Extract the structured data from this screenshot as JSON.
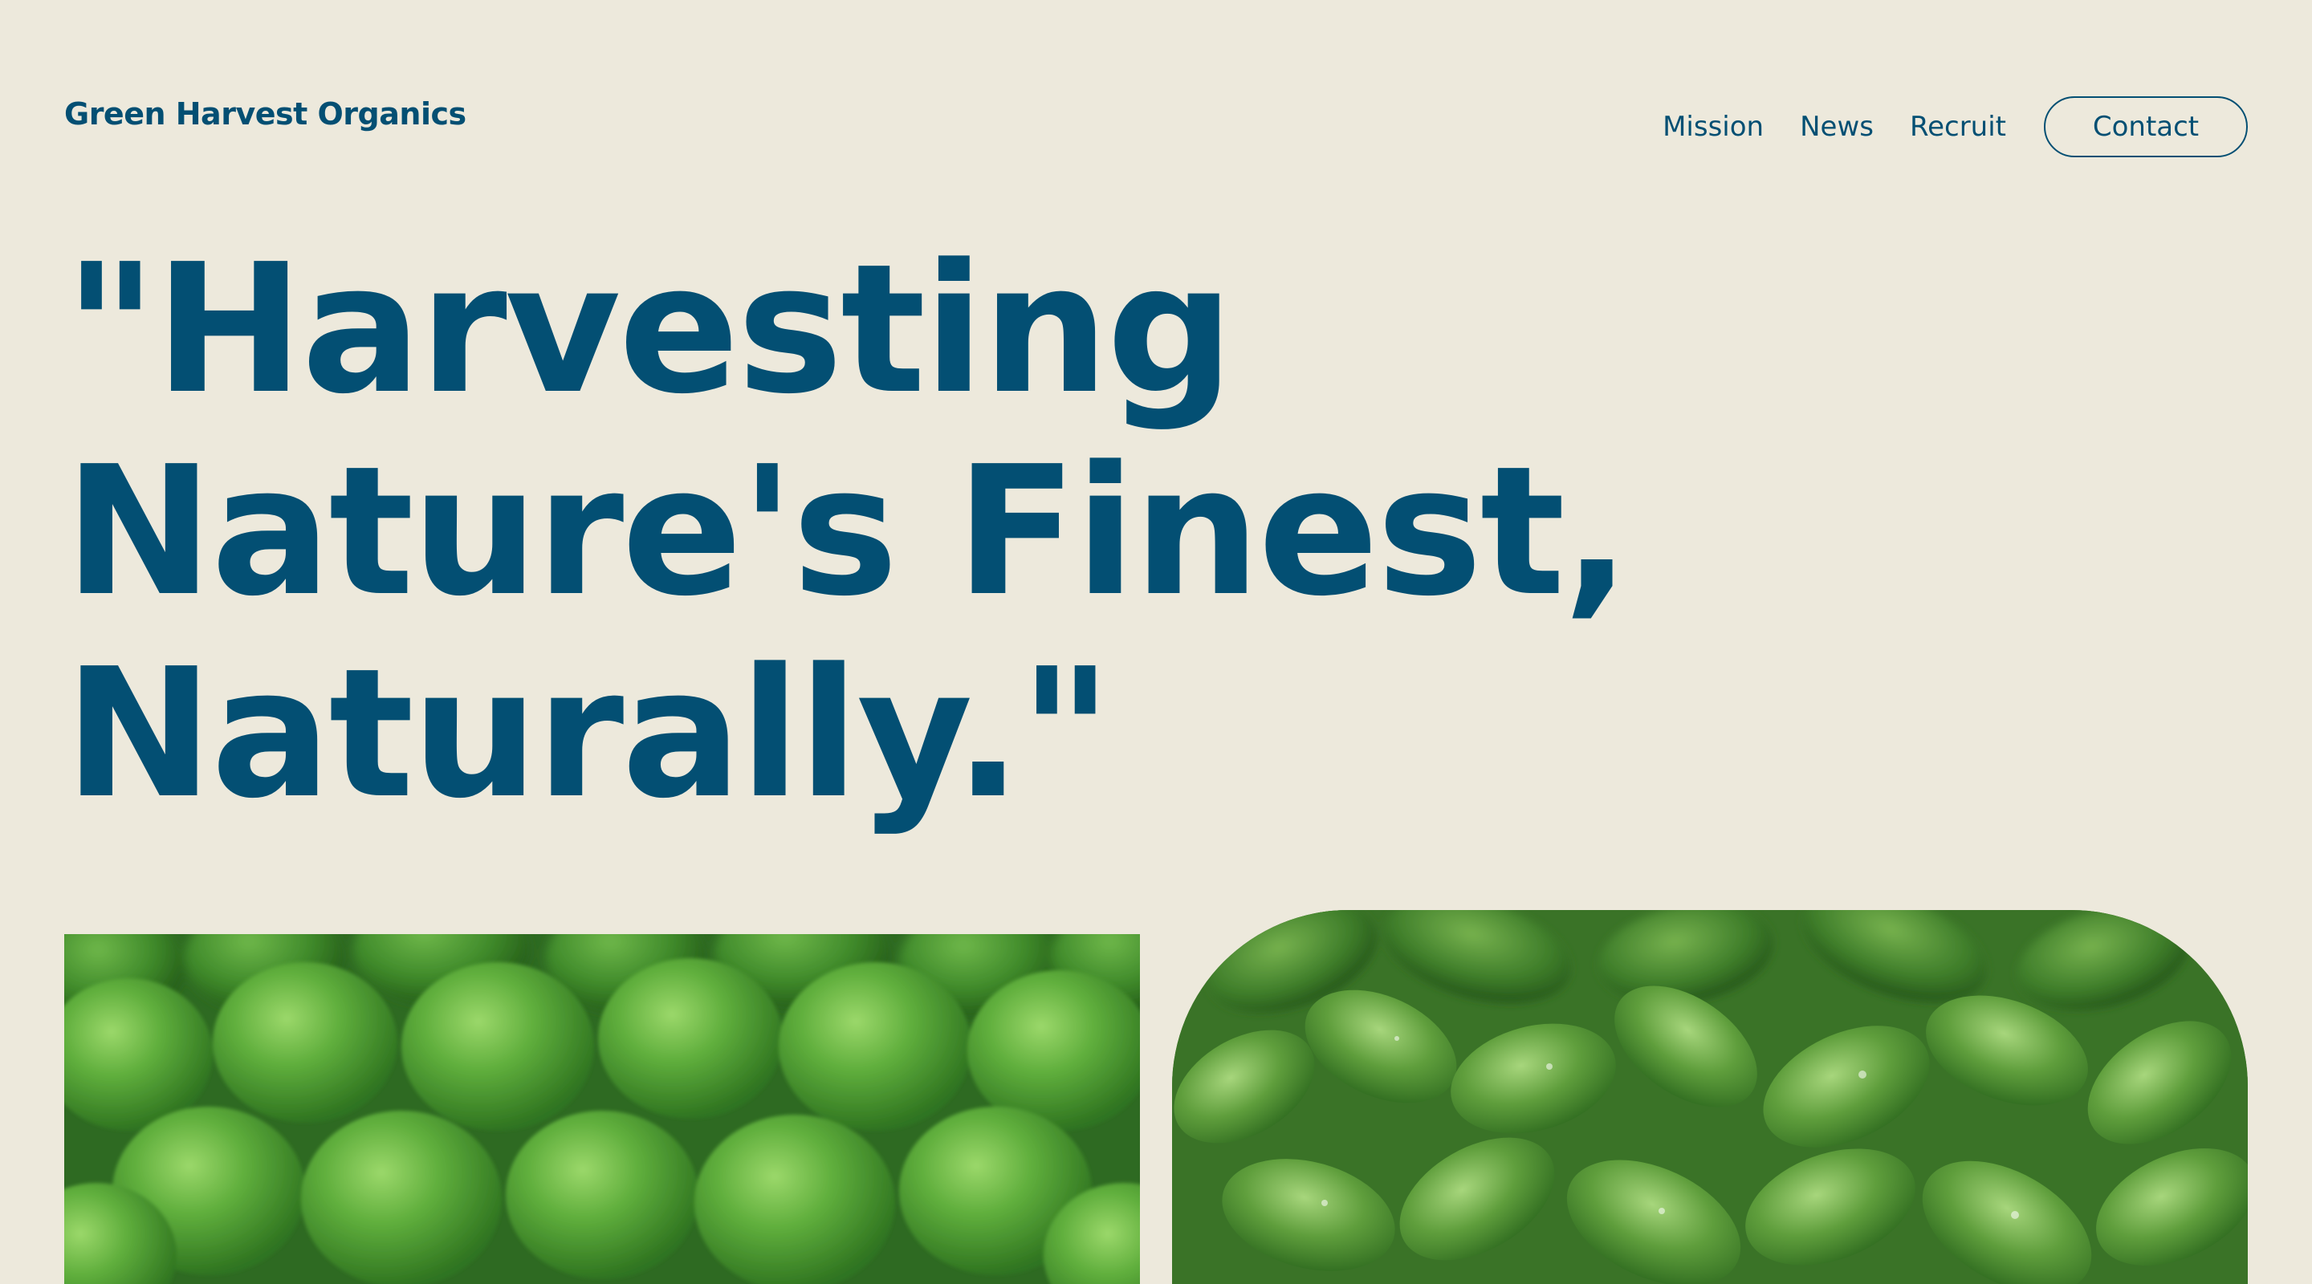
{
  "header": {
    "brand": "Green Harvest Organics",
    "nav": [
      {
        "label": "Mission"
      },
      {
        "label": "News"
      },
      {
        "label": "Recruit"
      }
    ],
    "contact_label": "Contact"
  },
  "hero": {
    "headline_lines": [
      "\"Harvesting",
      "Nature's Finest,",
      "Naturally.\""
    ]
  },
  "gallery": {
    "images": [
      {
        "subject": "green peas"
      },
      {
        "subject": "leafy greens"
      }
    ]
  },
  "colors": {
    "background": "#ede9dc",
    "primary": "#034f73"
  }
}
